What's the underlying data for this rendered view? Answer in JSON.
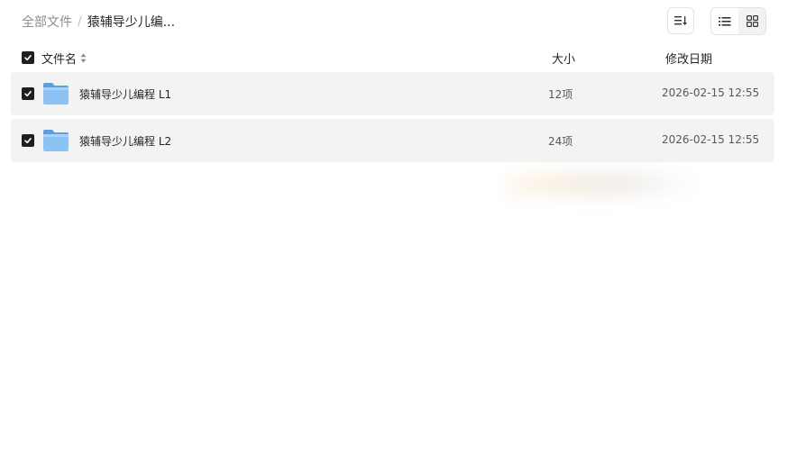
{
  "breadcrumb": {
    "root": "全部文件",
    "separator": "/",
    "current": "猿辅导少儿编..."
  },
  "toolbar": {
    "sort_icon": "sort-icon",
    "list_view_icon": "list-view-icon",
    "grid_view_icon": "grid-view-icon"
  },
  "header": {
    "select_all_checked": true,
    "name": "文件名",
    "size": "大小",
    "date": "修改日期"
  },
  "files": [
    {
      "name": "猿辅导少儿编程 L1",
      "size": "12项",
      "modified": "2026-02-15 12:55",
      "checked": true,
      "icon": "folder-icon"
    },
    {
      "name": "猿辅导少儿编程 L2",
      "size": "24项",
      "modified": "2026-02-15 12:55",
      "checked": true,
      "icon": "folder-icon"
    }
  ],
  "colors": {
    "row_bg": "#f3f3f3",
    "checkbox": "#1f1f1f",
    "folder_blue": "#7fb8f0"
  }
}
